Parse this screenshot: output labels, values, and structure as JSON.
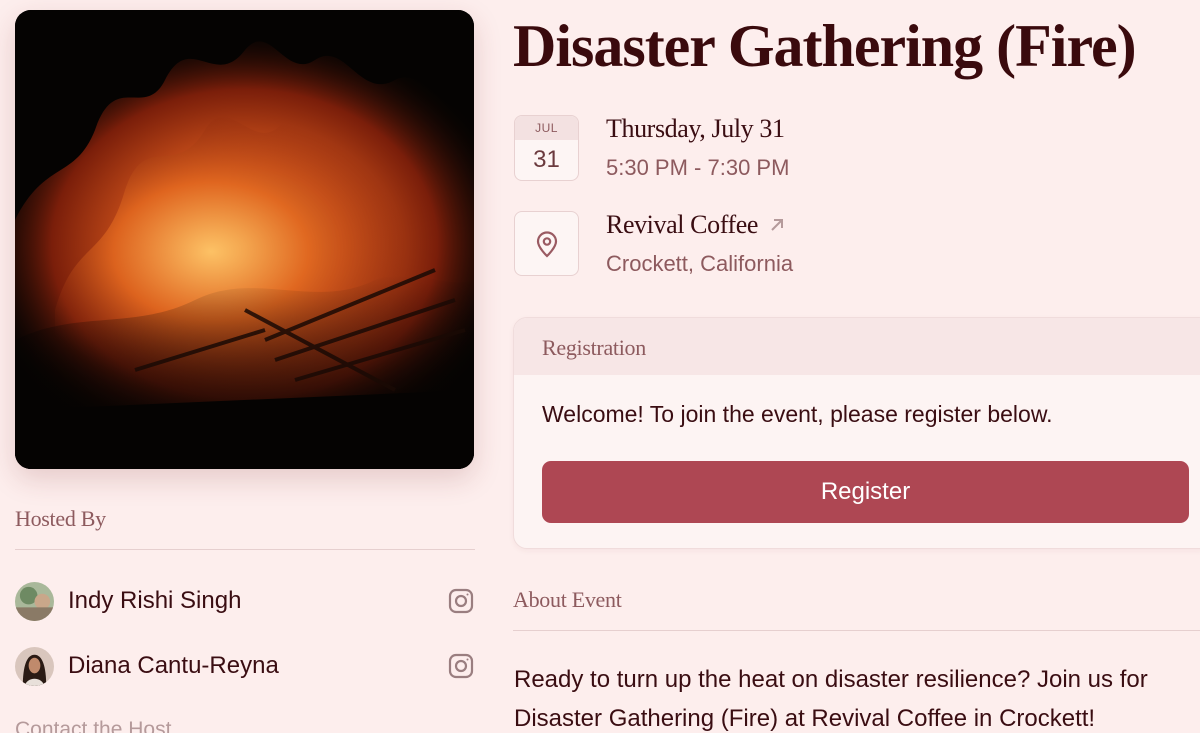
{
  "event": {
    "title": "Disaster Gathering (Fire)",
    "date": {
      "month": "JUL",
      "day": "31",
      "full": "Thursday, July 31",
      "time": "5:30 PM - 7:30 PM"
    },
    "location": {
      "venue": "Revival Coffee",
      "city": "Crockett, California"
    }
  },
  "hosts": {
    "label": "Hosted By",
    "items": [
      {
        "name": "Indy Rishi Singh",
        "social": "instagram-icon"
      },
      {
        "name": "Diana Cantu-Reyna",
        "social": "instagram-icon"
      }
    ],
    "contact_label": "Contact the Host"
  },
  "registration": {
    "header": "Registration",
    "message": "Welcome! To join the event, please register below.",
    "button_label": "Register"
  },
  "about": {
    "label": "About Event",
    "text": "Ready to turn up the heat on disaster resilience? Join us for Disaster Gathering (Fire) at Revival Coffee in Crockett!"
  },
  "colors": {
    "background": "#fdeeed",
    "accent": "#ae4753",
    "text_primary": "#3a0d12",
    "text_muted": "#8d5a5e"
  }
}
